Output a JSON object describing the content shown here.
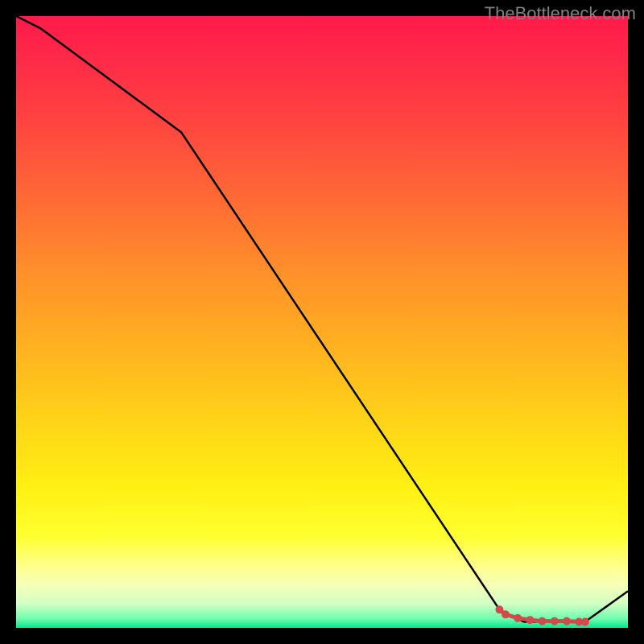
{
  "watermark": "TheBottleneck.com",
  "chart_data": {
    "type": "line",
    "title": "",
    "xlabel": "",
    "ylabel": "",
    "xlim": [
      0,
      100
    ],
    "ylim": [
      0,
      100
    ],
    "series": [
      {
        "name": "main-curve",
        "color": "#000000",
        "x": [
          0,
          4,
          27,
          79,
          83,
          90,
          93,
          100
        ],
        "values": [
          100,
          98,
          81,
          3,
          1,
          1,
          1,
          6
        ]
      }
    ],
    "markers": {
      "name": "highlight-segment",
      "color": "#d24a4a",
      "x": [
        79,
        80,
        82,
        84,
        86,
        88,
        90,
        92,
        93
      ],
      "values": [
        3,
        2.2,
        1.6,
        1.3,
        1.1,
        1.1,
        1.1,
        1.0,
        1.0
      ]
    },
    "gradient_stops": [
      {
        "pos": 0.0,
        "color": "#ff1a4a"
      },
      {
        "pos": 0.07,
        "color": "#ff2a48"
      },
      {
        "pos": 0.17,
        "color": "#ff4340"
      },
      {
        "pos": 0.3,
        "color": "#ff6a34"
      },
      {
        "pos": 0.42,
        "color": "#ff902a"
      },
      {
        "pos": 0.55,
        "color": "#ffb41f"
      },
      {
        "pos": 0.67,
        "color": "#ffd617"
      },
      {
        "pos": 0.77,
        "color": "#fff013"
      },
      {
        "pos": 0.85,
        "color": "#ffff30"
      },
      {
        "pos": 0.9,
        "color": "#ffff8e"
      },
      {
        "pos": 0.93,
        "color": "#f5ffb8"
      },
      {
        "pos": 0.96,
        "color": "#d4ffc4"
      },
      {
        "pos": 0.985,
        "color": "#6effae"
      },
      {
        "pos": 1.0,
        "color": "#00e58e"
      }
    ]
  }
}
